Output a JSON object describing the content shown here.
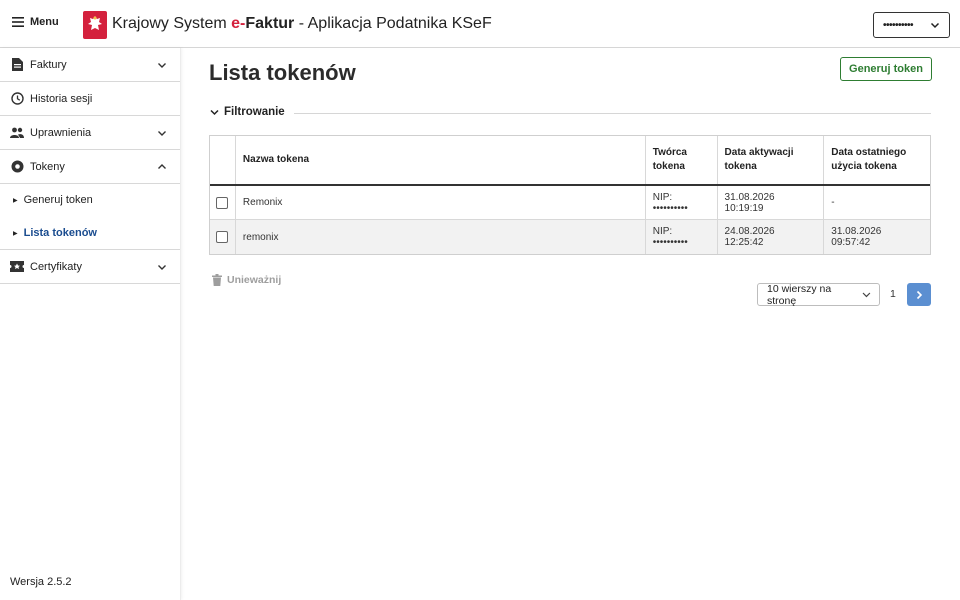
{
  "header": {
    "menu_label": "Menu",
    "title_prefix": "Krajowy System ",
    "title_e": "e-",
    "title_bold": "Faktur",
    "title_suffix": " - Aplikacja Podatnika KSeF",
    "user_masked": "••••••••••"
  },
  "sidebar": {
    "items": [
      {
        "label": "Faktury",
        "icon": "document-icon",
        "chevron": "down"
      },
      {
        "label": "Historia sesji",
        "icon": "clock-icon"
      },
      {
        "label": "Uprawnienia",
        "icon": "people-icon",
        "chevron": "down"
      },
      {
        "label": "Tokeny",
        "icon": "token-icon",
        "chevron": "up"
      }
    ],
    "subitems": [
      {
        "label": "Generuj token",
        "active": false
      },
      {
        "label": "Lista tokenów",
        "active": true
      }
    ],
    "after": {
      "label": "Certyfikaty",
      "icon": "certificate-icon",
      "chevron": "down"
    },
    "version": "Wersja 2.5.2"
  },
  "main": {
    "title": "Lista tokenów",
    "generate_button": "Generuj token",
    "filter_label": "Filtrowanie",
    "table": {
      "headers": [
        "Nazwa tokena",
        "Twórca tokena",
        "Data aktywacji tokena",
        "Data ostatniego użycia tokena"
      ],
      "header_lines": [
        [
          "Nazwa tokena"
        ],
        [
          "Twórca",
          "tokena"
        ],
        [
          "Data aktywacji",
          "tokena"
        ],
        [
          "Data ostatniego",
          "użycia tokena"
        ]
      ],
      "rows": [
        {
          "name": "Remonix",
          "creator": "NIP: ••••••••••",
          "activated": "31.08.2026 10:19:19",
          "last_used": "-"
        },
        {
          "name": "remonix",
          "creator": "NIP: ••••••••••",
          "activated": "24.08.2026 12:25:42",
          "last_used": "31.08.2026 09:57:42"
        }
      ]
    },
    "revoke_label": "Unieważnij",
    "page_size": "10 wierszy na stronę",
    "current_page": "1"
  },
  "colors": {
    "brand_red": "#d4213d",
    "accent_green": "#2e7d32",
    "active_link": "#1a4c8f",
    "pager_blue": "#5b8fd1"
  }
}
